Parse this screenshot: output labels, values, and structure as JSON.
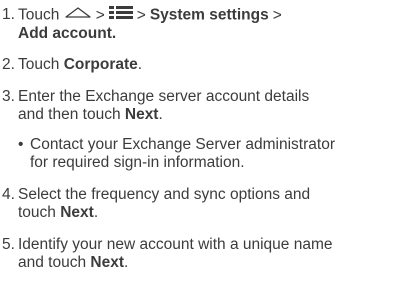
{
  "steps": [
    {
      "number": "1.",
      "line1": {
        "prefix": "Touch",
        "icon1": "home-icon",
        "sep1": ">",
        "icon2": "menu-icon",
        "sep2": ">",
        "item1": "System settings",
        "sep3": ">"
      },
      "line2": {
        "item2": "Add account",
        "suffix": "."
      }
    },
    {
      "number": "2.",
      "prefix": "Touch",
      "bold": "Corporate",
      "suffix": "."
    },
    {
      "number": "3.",
      "line1": "Enter the Exchange server account details",
      "line2_prefix": "and then touch",
      "bold": "Next",
      "suffix": ".",
      "bullet": {
        "symbol": "•",
        "line1": "Contact your Exchange Server administrator",
        "line2": "for required sign-in information."
      }
    },
    {
      "number": "4.",
      "line1": "Select the frequency and sync options and",
      "line2_prefix": "touch",
      "bold": "Next",
      "suffix": "."
    },
    {
      "number": "5.",
      "line1": "Identify your new account with a unique name",
      "line2_prefix": "and touch",
      "bold": "Next",
      "suffix": "."
    }
  ]
}
